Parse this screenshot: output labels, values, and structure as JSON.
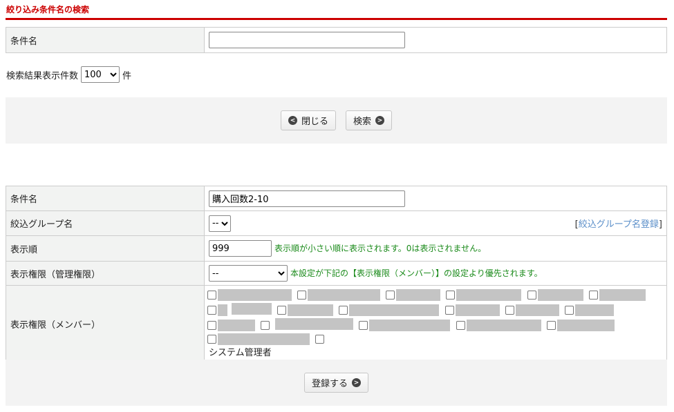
{
  "header": {
    "title": "絞り込み条件名の検索"
  },
  "search": {
    "condition_label": "条件名",
    "condition_value": "",
    "count_label": "検索結果表示件数",
    "count_value": "100",
    "count_unit": "件"
  },
  "search_buttons": {
    "close": "閉じる",
    "search": "検索"
  },
  "form": {
    "condition_label": "条件名",
    "condition_value": "購入回数2-10",
    "group_label": "絞込グループ名",
    "group_value": "--",
    "group_link": "絞込グループ名登録",
    "bracket_open": "[",
    "bracket_close": "]",
    "order_label": "表示順",
    "order_value": "999",
    "order_note": "表示順が小さい順に表示されます。0は表示されません。",
    "admin_perm_label": "表示権限（管理権限）",
    "admin_perm_value": "--",
    "admin_perm_note": "本設定が下記の【表示権限（メンバー）】の設定より優先されます。",
    "member_perm_label": "表示権限（メンバー）",
    "member_last": "システム管理者"
  },
  "footer": {
    "register": "登録する"
  }
}
